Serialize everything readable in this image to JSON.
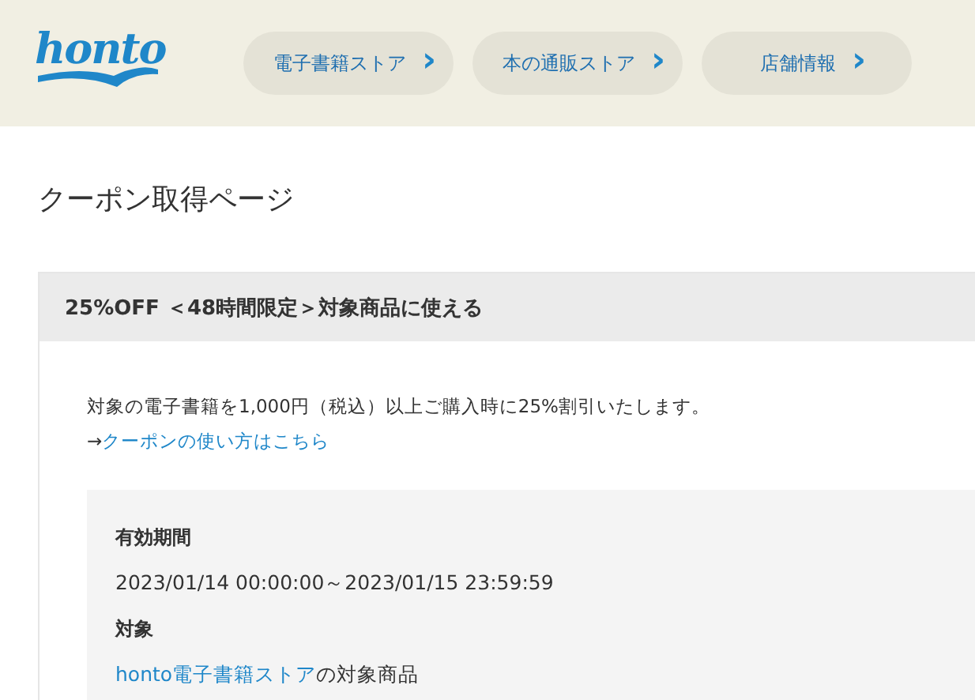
{
  "header": {
    "logo": "honto",
    "nav": [
      {
        "label": "電子書籍ストア",
        "chevron": "›"
      },
      {
        "label": "本の通販ストア",
        "chevron": "›"
      },
      {
        "label": "店舗情報",
        "chevron": "›"
      }
    ]
  },
  "page_title": "クーポン取得ページ",
  "coupon": {
    "title": "25%OFF ＜48時間限定＞対象商品に使える",
    "description": "対象の電子書籍を1,000円（税込）以上ご購入時に25%割引いたします。",
    "guide": {
      "prefix": "→",
      "link": "クーポンの使い方はこちら"
    },
    "details": [
      {
        "label": "有効期間",
        "value": {
          "text": "2023/01/14 00:00:00～2023/01/15 23:59:59"
        }
      },
      {
        "label": "対象",
        "value": {
          "link": "honto電子書籍ストア",
          "text": "の対象商品"
        }
      }
    ]
  }
}
